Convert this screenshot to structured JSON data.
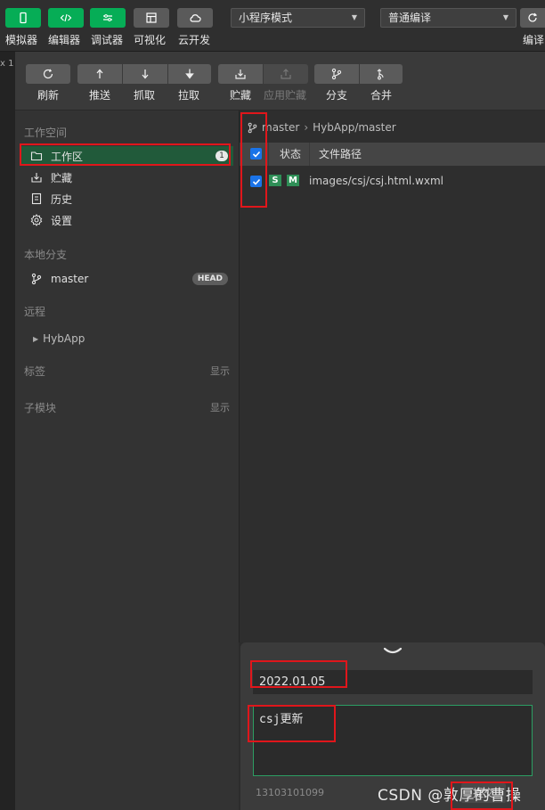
{
  "topbar": {
    "buttons": [
      {
        "label": "模拟器",
        "icon": "phone-icon"
      },
      {
        "label": "编辑器",
        "icon": "code-icon"
      },
      {
        "label": "调试器",
        "icon": "debug-icon"
      },
      {
        "label": "可视化",
        "icon": "layout-icon"
      },
      {
        "label": "云开发",
        "icon": "cloud-icon"
      }
    ],
    "mode_select": "小程序模式",
    "compile_select": "普通编译",
    "compile_label": "编译",
    "colors": {
      "accent_green": "#06ad56"
    }
  },
  "left_strip_text": "x 1",
  "git_toolbar": [
    {
      "label": "刷新",
      "icon": "refresh-icon",
      "enabled": true
    },
    {
      "label": "推送",
      "icon": "push-icon",
      "enabled": true
    },
    {
      "label": "抓取",
      "icon": "fetch-icon",
      "enabled": true
    },
    {
      "label": "拉取",
      "icon": "pull-icon",
      "enabled": true
    },
    {
      "label": "贮藏",
      "icon": "stash-icon",
      "enabled": true
    },
    {
      "label": "应用贮藏",
      "icon": "apply-stash-icon",
      "enabled": false
    },
    {
      "label": "分支",
      "icon": "branch-icon",
      "enabled": true
    },
    {
      "label": "合并",
      "icon": "merge-icon",
      "enabled": true
    }
  ],
  "sidebar": {
    "workspace_title": "工作空间",
    "workspace_items": [
      {
        "label": "工作区",
        "icon": "folder-icon",
        "badge": "1",
        "active": true
      },
      {
        "label": "贮藏",
        "icon": "stash-icon"
      },
      {
        "label": "历史",
        "icon": "history-icon"
      },
      {
        "label": "设置",
        "icon": "gear-icon"
      }
    ],
    "local_branch_title": "本地分支",
    "branch": {
      "label": "master",
      "badge": "HEAD"
    },
    "remote_title": "远程",
    "remote_item": "HybApp",
    "tags_title": "标签",
    "tags_action": "显示",
    "submodule_title": "子模块",
    "submodule_action": "显示"
  },
  "main": {
    "breadcrumb": {
      "branch": "master",
      "sep": "›",
      "remote": "HybApp/master"
    },
    "table": {
      "headers": {
        "status": "状态",
        "path": "文件路径"
      },
      "rows": [
        {
          "checked": true,
          "badges": [
            "S",
            "M"
          ],
          "path": "images/csj/csj.html.wxml"
        }
      ]
    }
  },
  "commit": {
    "summary": "2022.01.05",
    "description": "csj更新",
    "author": "13103101099",
    "button": "提交"
  },
  "watermark": "CSDN @敦厚的曹操"
}
